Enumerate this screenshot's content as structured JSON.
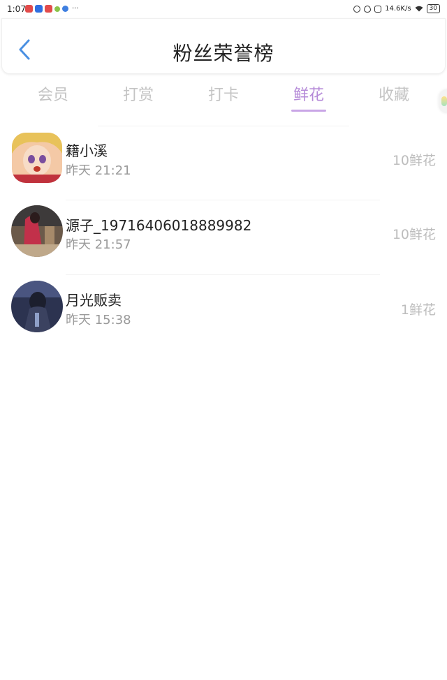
{
  "status_bar": {
    "time": "1:07",
    "dots": "···",
    "net_speed": "14.6K/s",
    "battery": "30"
  },
  "header": {
    "title": "粉丝荣誉榜"
  },
  "tabs": [
    {
      "label": "会员"
    },
    {
      "label": "打赏"
    },
    {
      "label": "打卡"
    },
    {
      "label": "鲜花",
      "active": true
    },
    {
      "label": "收藏"
    }
  ],
  "colors": {
    "accent": "#b58ad8",
    "back_icon": "#4a90e2",
    "muted_text": "#9a9a9a"
  },
  "fans": [
    {
      "name": "籍小溪",
      "time": "昨天 21:21",
      "amount": "10鲜花"
    },
    {
      "name": "源子_19716406018889982",
      "time": "昨天 21:57",
      "amount": "10鲜花"
    },
    {
      "name": "月光贩卖",
      "time": "昨天 15:38",
      "amount": "1鲜花"
    }
  ]
}
